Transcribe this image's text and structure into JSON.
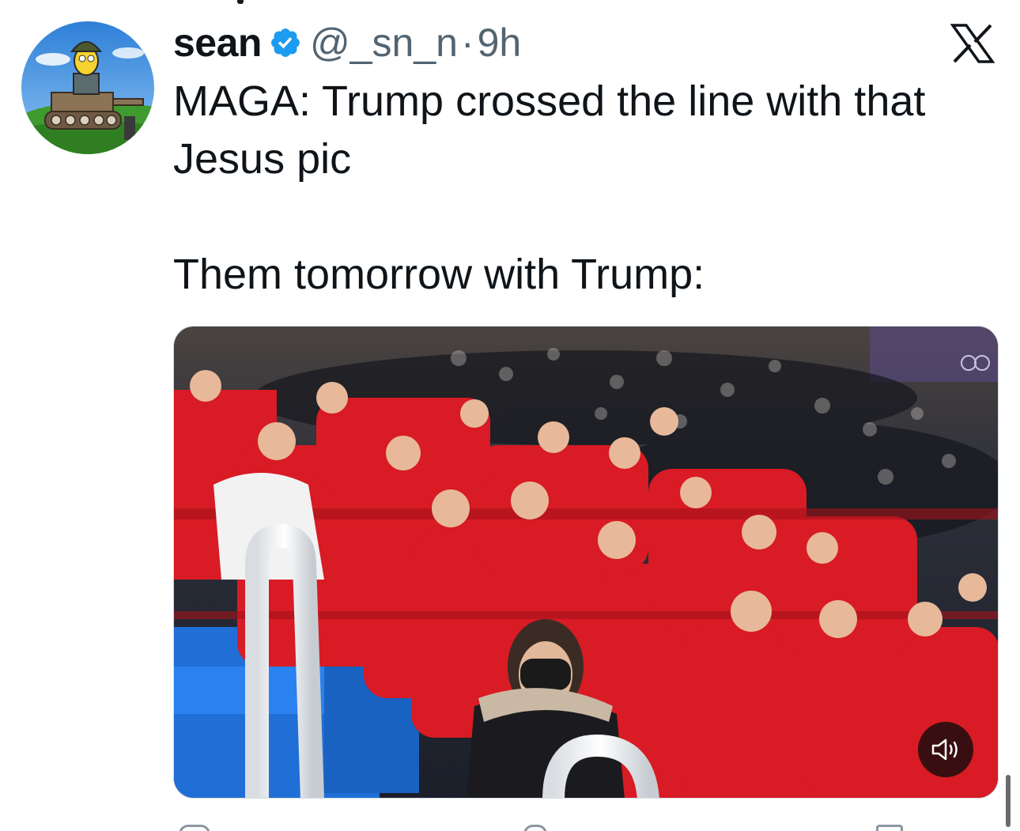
{
  "tweet": {
    "display_name": "sean",
    "handle": "@_sn_n",
    "separator": "·",
    "time": "9h",
    "text_lines": [
      "MAGA: Trump crossed the line with that",
      "Jesus pic"
    ],
    "text_lines_2": [
      "Them tomorrow with Trump:"
    ]
  },
  "icons": {
    "verified": "verified-badge-icon",
    "platform": "x-logo-icon",
    "sound": "speaker-icon"
  },
  "colors": {
    "verified_blue": "#1d9bf0",
    "text_primary": "#0f1419",
    "text_secondary": "#536471",
    "jacket_red": "#d81b24",
    "seat_blue": "#1f6fd6"
  }
}
